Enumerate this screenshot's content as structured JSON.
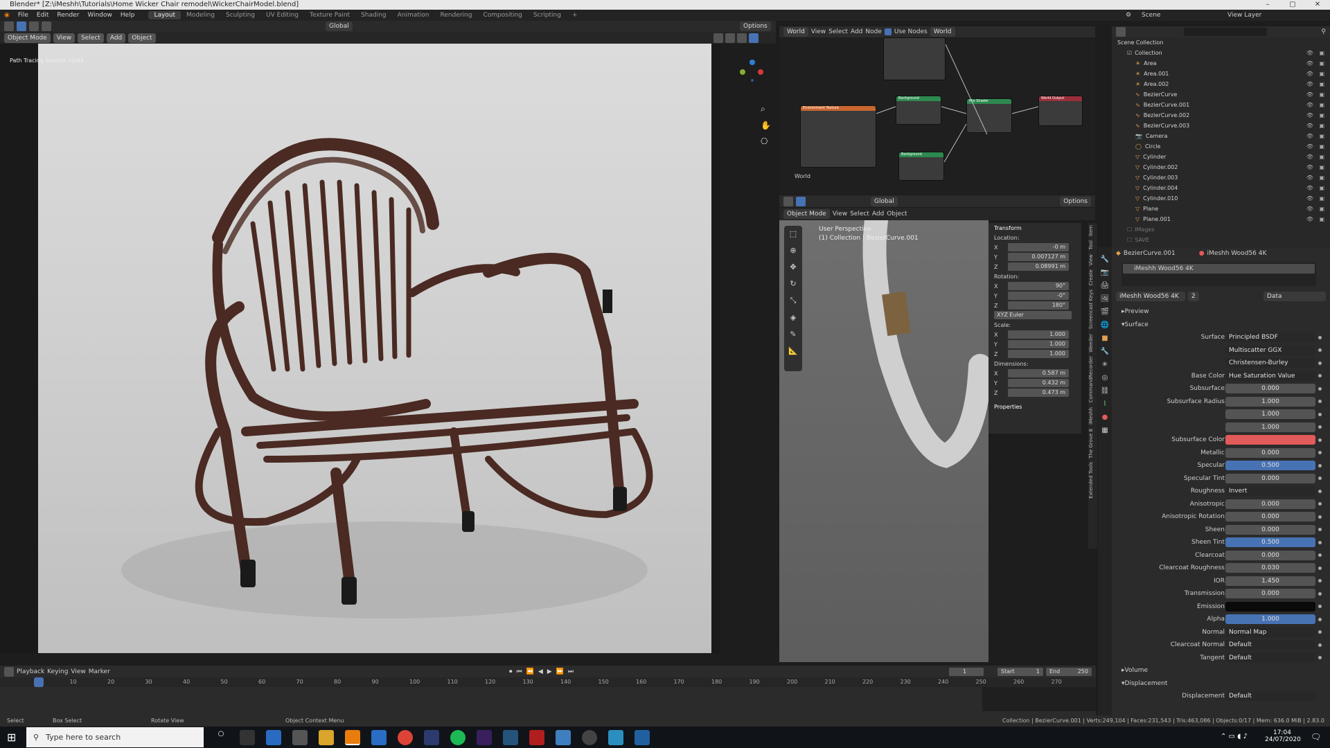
{
  "title": "Blender* [Z:\\iMeshh\\Tutorials\\Home Wicker Chair remodel\\WickerChairModel.blend]",
  "menus": [
    "File",
    "Edit",
    "Render",
    "Window",
    "Help"
  ],
  "workspaces": [
    "Layout",
    "Modeling",
    "Sculpting",
    "UV Editing",
    "Texture Paint",
    "Shading",
    "Animation",
    "Rendering",
    "Compositing",
    "Scripting",
    "+"
  ],
  "active_workspace": "Layout",
  "top_right": {
    "scene": "Scene",
    "view_layer": "View Layer"
  },
  "viewport": {
    "mode": "Object Mode",
    "menu": [
      "View",
      "Select",
      "Add",
      "Object"
    ],
    "transform": "Global",
    "options": "Options",
    "overlay_text": "Path Tracing Sample 32/64"
  },
  "node_editor": {
    "world": "World",
    "menu": [
      "View",
      "Select",
      "Add",
      "Node"
    ],
    "use_nodes": "Use Nodes",
    "world_name": "World",
    "label": "World",
    "nodes": [
      "Environment Texture",
      "Background",
      "Mix Shader",
      "World Output",
      "Background"
    ]
  },
  "viewport2": {
    "mode": "Object Mode",
    "menu": [
      "View",
      "Select",
      "Add",
      "Object"
    ],
    "transform": "Global",
    "options": "Options",
    "info1": "User Perspective",
    "info2": "(1) Collection | BezierCurve.001"
  },
  "transform_panel": {
    "title": "Transform",
    "location": "Location:",
    "rotation": "Rotation:",
    "scale": "Scale:",
    "dimensions": "Dimensions:",
    "euler": "XYZ Euler",
    "properties": "Properties",
    "loc": [
      {
        "a": "X",
        "v": "-0 m"
      },
      {
        "a": "Y",
        "v": "0.007127 m"
      },
      {
        "a": "Z",
        "v": "0.08991 m"
      }
    ],
    "rot": [
      {
        "a": "X",
        "v": "90°"
      },
      {
        "a": "Y",
        "v": "-0°"
      },
      {
        "a": "Z",
        "v": "180°"
      }
    ],
    "scl": [
      {
        "a": "X",
        "v": "1.000"
      },
      {
        "a": "Y",
        "v": "1.000"
      },
      {
        "a": "Z",
        "v": "1.000"
      }
    ],
    "dim": [
      {
        "a": "X",
        "v": "0.587 m"
      },
      {
        "a": "Y",
        "v": "0.432 m"
      },
      {
        "a": "Z",
        "v": "0.473 m"
      }
    ]
  },
  "side_tabs": [
    "Item",
    "Tool",
    "View",
    "Create",
    "Screencast Keys",
    "Weeder",
    "CommandRecorder",
    "iMeshh",
    "The Grove 8",
    "Extended Tools"
  ],
  "outliner": {
    "root": "Scene Collection",
    "collection": "Collection",
    "items": [
      "Area",
      "Area.001",
      "Area.002",
      "BezierCurve",
      "BezierCurve.001",
      "BezierCurve.002",
      "BezierCurve.003",
      "Camera",
      "Circle",
      "Cylinder",
      "Cylinder.002",
      "Cylinder.003",
      "Cylinder.004",
      "Cylinder.010",
      "Plane",
      "Plane.001"
    ],
    "extra": [
      "IMages",
      "SAVE"
    ]
  },
  "properties": {
    "object": "BezierCurve.001",
    "material": "iMeshh Wood56 4K",
    "slot": "iMeshh Wood56 4K",
    "users": "2",
    "data": "Data",
    "preview": "Preview",
    "surface_section": "Surface",
    "rows": [
      {
        "l": "Surface",
        "v": "Principled BSDF",
        "t": "sel"
      },
      {
        "l": "",
        "v": "Multiscatter GGX",
        "t": "sel"
      },
      {
        "l": "",
        "v": "Christensen-Burley",
        "t": "sel"
      },
      {
        "l": "Base Color",
        "v": "Hue Saturation Value",
        "t": "sel"
      },
      {
        "l": "Subsurface",
        "v": "0.000",
        "t": ""
      },
      {
        "l": "Subsurface Radius",
        "v": "1.000",
        "t": ""
      },
      {
        "l": "",
        "v": "1.000",
        "t": ""
      },
      {
        "l": "",
        "v": "1.000",
        "t": ""
      },
      {
        "l": "Subsurface Color",
        "v": "",
        "t": "red"
      },
      {
        "l": "Metallic",
        "v": "0.000",
        "t": ""
      },
      {
        "l": "Specular",
        "v": "0.500",
        "t": "blue"
      },
      {
        "l": "Specular Tint",
        "v": "0.000",
        "t": ""
      },
      {
        "l": "Roughness",
        "v": "Invert",
        "t": "sel"
      },
      {
        "l": "Anisotropic",
        "v": "0.000",
        "t": ""
      },
      {
        "l": "Anisotropic Rotation",
        "v": "0.000",
        "t": ""
      },
      {
        "l": "Sheen",
        "v": "0.000",
        "t": ""
      },
      {
        "l": "Sheen Tint",
        "v": "0.500",
        "t": "blue"
      },
      {
        "l": "Clearcoat",
        "v": "0.000",
        "t": ""
      },
      {
        "l": "Clearcoat Roughness",
        "v": "0.030",
        "t": ""
      },
      {
        "l": "IOR",
        "v": "1.450",
        "t": ""
      },
      {
        "l": "Transmission",
        "v": "0.000",
        "t": ""
      },
      {
        "l": "Emission",
        "v": "",
        "t": "blk"
      },
      {
        "l": "Alpha",
        "v": "1.000",
        "t": "blue"
      },
      {
        "l": "Normal",
        "v": "Normal Map",
        "t": "sel"
      },
      {
        "l": "Clearcoat Normal",
        "v": "Default",
        "t": "sel"
      },
      {
        "l": "Tangent",
        "v": "Default",
        "t": "sel"
      }
    ],
    "volume": "Volume",
    "displacement_section": "Displacement",
    "displacement": "Displacement",
    "displacement_val": "Default"
  },
  "timeline": {
    "menu": [
      "Playback",
      "Keying",
      "View",
      "Marker"
    ],
    "current": "1",
    "start_label": "Start",
    "start": "1",
    "end_label": "End",
    "end": "250",
    "ticks": [
      "0",
      "10",
      "20",
      "30",
      "40",
      "50",
      "60",
      "70",
      "80",
      "90",
      "100",
      "110",
      "120",
      "130",
      "140",
      "150",
      "160",
      "170",
      "180",
      "190",
      "200",
      "210",
      "220",
      "230",
      "240",
      "250",
      "260",
      "270"
    ]
  },
  "status": {
    "select": "Select",
    "box": "Box Select",
    "rotate": "Rotate View",
    "ctx": "Object Context Menu",
    "info": "Collection | BezierCurve.001 | Verts:249,104 | Faces:231,543 | Tris:463,086 | Objects:0/17 | Mem: 636.0 MiB | 2.83.0"
  },
  "taskbar": {
    "search": "Type here to search",
    "time": "17:04",
    "date": "24/07/2020"
  }
}
